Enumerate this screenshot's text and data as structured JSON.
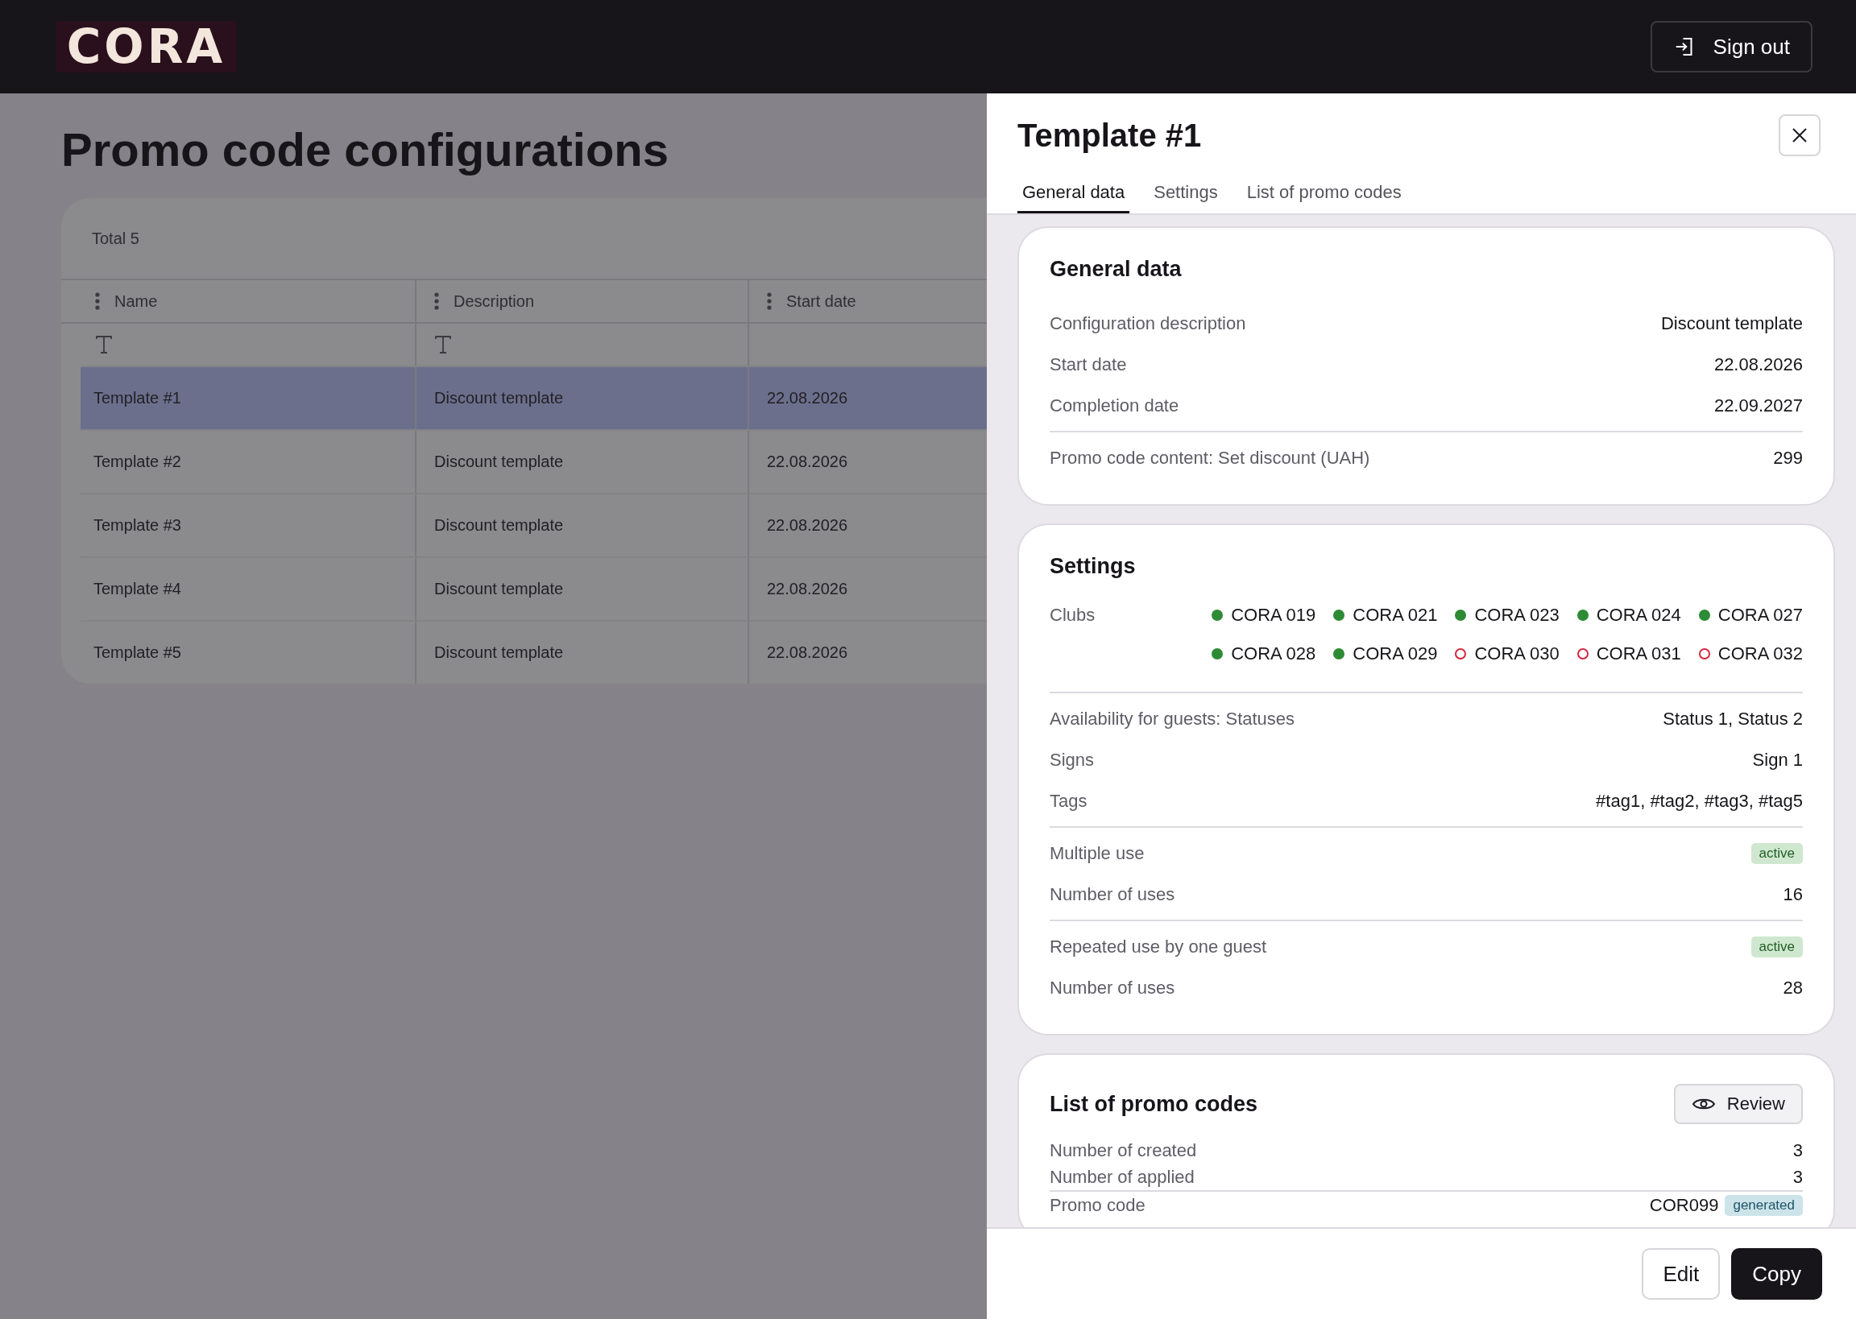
{
  "header": {
    "logo": "CORA",
    "sign_out": "Sign out"
  },
  "page": {
    "title": "Promo code configurations",
    "total": "Total 5",
    "columns": [
      {
        "label": "Name",
        "filter": true
      },
      {
        "label": "Description",
        "filter": true
      },
      {
        "label": "Start date",
        "filter": false
      }
    ],
    "rows": [
      {
        "cells": [
          "Template #1",
          "Discount template",
          "22.08.2026"
        ],
        "selected": true
      },
      {
        "cells": [
          "Template #2",
          "Discount template",
          "22.08.2026"
        ],
        "selected": false
      },
      {
        "cells": [
          "Template #3",
          "Discount template",
          "22.08.2026"
        ],
        "selected": false
      },
      {
        "cells": [
          "Template #4",
          "Discount template",
          "22.08.2026"
        ],
        "selected": false
      },
      {
        "cells": [
          "Template #5",
          "Discount template",
          "22.08.2026"
        ],
        "selected": false
      }
    ]
  },
  "panel": {
    "title": "Template #1",
    "tabs": [
      {
        "label": "General data",
        "selected": true
      },
      {
        "label": "Settings",
        "selected": false
      },
      {
        "label": "List of promo codes",
        "selected": false
      }
    ],
    "general_data": {
      "title": "General data",
      "groups": [
        [
          {
            "label": "Configuration description",
            "value": "Discount template"
          },
          {
            "label": "Start date",
            "value": "22.08.2026"
          },
          {
            "label": "Completion date",
            "value": "22.09.2027"
          }
        ],
        [
          {
            "label": "Promo code content: Set discount (UAH)",
            "value": "299"
          }
        ]
      ]
    },
    "settings": {
      "title": "Settings",
      "clubs_label": "Clubs",
      "clubs": [
        {
          "name": "CORA 019",
          "active": true
        },
        {
          "name": "CORA 021",
          "active": true
        },
        {
          "name": "CORA 023",
          "active": true
        },
        {
          "name": "CORA 024",
          "active": true
        },
        {
          "name": "CORA 027",
          "active": true
        },
        {
          "name": "CORA 028",
          "active": true
        },
        {
          "name": "CORA 029",
          "active": true
        },
        {
          "name": "CORA 030",
          "active": false
        },
        {
          "name": "CORA 031",
          "active": false
        },
        {
          "name": "CORA 032",
          "active": false
        }
      ],
      "groups": [
        [
          {
            "label": "Availability for guests: Statuses",
            "value": "Status 1, Status 2"
          },
          {
            "label": "Signs",
            "value": "Sign 1"
          },
          {
            "label": "Tags",
            "value": "#tag1, #tag2, #tag3, #tag5"
          }
        ],
        [
          {
            "label": "Multiple use",
            "badge": {
              "text": "active",
              "kind": "success"
            }
          },
          {
            "label": "Number of uses",
            "value": "16"
          }
        ],
        [
          {
            "label": "Repeated use by one guest",
            "badge": {
              "text": "active",
              "kind": "success"
            }
          },
          {
            "label": "Number of uses",
            "value": "28"
          }
        ]
      ]
    },
    "promo_codes": {
      "title": "List of promo codes",
      "review_button": "Review",
      "rows": [
        {
          "label": "Number of created",
          "value": "3"
        },
        {
          "label": "Number of applied",
          "value": "3"
        }
      ],
      "code_row": {
        "label": "Promo code",
        "value": "COR099",
        "badge": {
          "text": "generated",
          "kind": "info"
        }
      }
    }
  },
  "footer": {
    "buttons": [
      {
        "label": "Edit",
        "kind": "secondary"
      },
      {
        "label": "Copy",
        "kind": "primary"
      }
    ]
  }
}
